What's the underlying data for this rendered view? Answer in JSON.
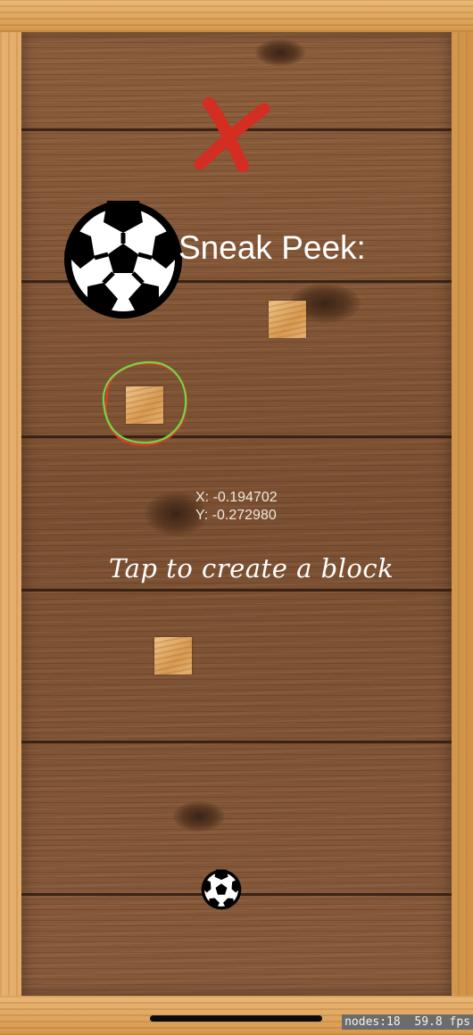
{
  "game": {
    "title": "Sneak Peek:",
    "hint": "Tap to create a block",
    "coordinates": {
      "x_label": "X: -0.194702",
      "y_label": "Y: -0.272980"
    },
    "debug": {
      "nodes_label": "nodes:18",
      "fps_label": "59.8 fps"
    },
    "icons": {
      "close": "close-x-icon",
      "preview_ball": "soccer-ball-icon",
      "player_ball": "soccer-ball-icon"
    },
    "colors": {
      "close_mark": "#d42e22",
      "ring_red": "#e03a2a",
      "ring_green": "#6fd848",
      "text": "#ffffff"
    }
  }
}
